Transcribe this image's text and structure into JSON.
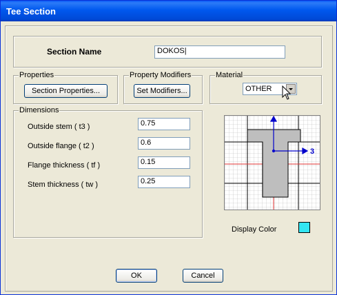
{
  "window": {
    "title": "Tee Section"
  },
  "section": {
    "name_label": "Section Name",
    "name_value": "DOKOS"
  },
  "properties": {
    "group_label": "Properties",
    "button_label": "Section Properties..."
  },
  "modifiers": {
    "group_label": "Property Modifiers",
    "button_label": "Set Modifiers..."
  },
  "material": {
    "group_label": "Material",
    "selected": "OTHER"
  },
  "dimensions": {
    "group_label": "Dimensions",
    "fields": [
      {
        "label": "Outside stem  ( t3 )",
        "value": "0.75"
      },
      {
        "label": "Outside flange  ( t2 )",
        "value": "0.6"
      },
      {
        "label": "Flange thickness  ( tf )",
        "value": "0.15"
      },
      {
        "label": "Stem thickness  ( tw )",
        "value": "0.25"
      }
    ]
  },
  "preview": {
    "axis_label": "3"
  },
  "display_color": {
    "label": "Display Color",
    "color": "#33E6F2"
  },
  "buttons": {
    "ok_label": "OK",
    "cancel_label": "Cancel"
  }
}
